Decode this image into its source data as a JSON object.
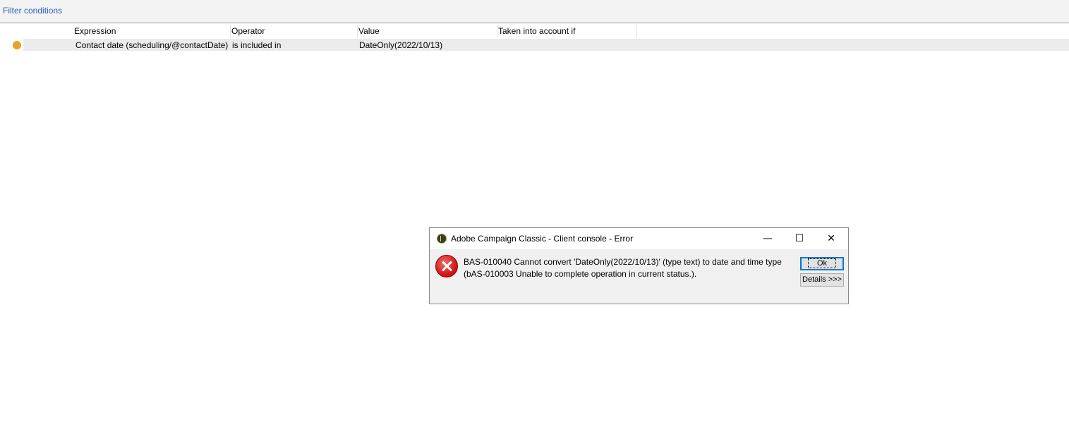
{
  "filter": {
    "title": "Filter conditions"
  },
  "table": {
    "columns": [
      "Expression",
      "Operator",
      "Value",
      "Taken into account if"
    ],
    "rows": [
      {
        "status_color": "#e8a12a",
        "expression": "Contact date (scheduling/@contactDate)",
        "operator": "is included in",
        "value": "DateOnly(2022/10/13)",
        "taken_into_account_if": ""
      }
    ]
  },
  "dialog": {
    "title": "Adobe Campaign Classic - Client console - Error",
    "icon": "error-icon",
    "message": "BAS-010040 Cannot convert 'DateOnly(2022/10/13)' (type text) to date and time type (bAS-010003 Unable to complete operation in current status.).",
    "ok_label": "Ok",
    "details_label": "Details >>>",
    "minimize_glyph": "—",
    "maximize_glyph": "☐",
    "close_glyph": "✕"
  }
}
